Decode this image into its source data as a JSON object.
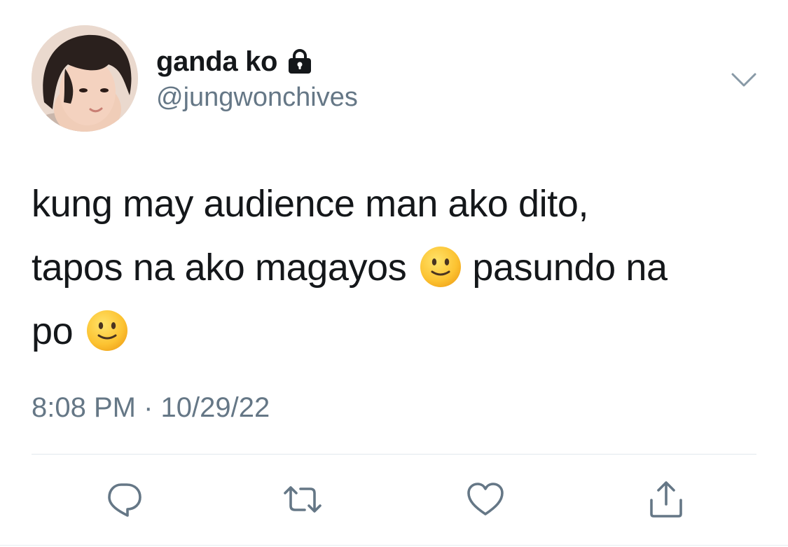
{
  "user": {
    "display_name": "ganda ko",
    "handle": "@jungwonchives",
    "avatar_icon": "profile-photo",
    "locked_icon": "lock-icon"
  },
  "tweet": {
    "line1": "kung may audience man ako dito,",
    "line2_a": "tapos na ako magayos",
    "line2_b": "pasundo na",
    "line3": "po",
    "emoji": "slightly-smiling-face",
    "timestamp": "8:08 PM · 10/29/22"
  },
  "actions": [
    {
      "name": "reply",
      "icon": "reply-icon"
    },
    {
      "name": "retweet",
      "icon": "retweet-icon"
    },
    {
      "name": "like",
      "icon": "heart-icon"
    },
    {
      "name": "share",
      "icon": "share-icon"
    }
  ],
  "colors": {
    "text": "#14171a",
    "secondary": "#657786",
    "divider": "#e1e8ed",
    "emoji_yellow": "#f7c534"
  }
}
